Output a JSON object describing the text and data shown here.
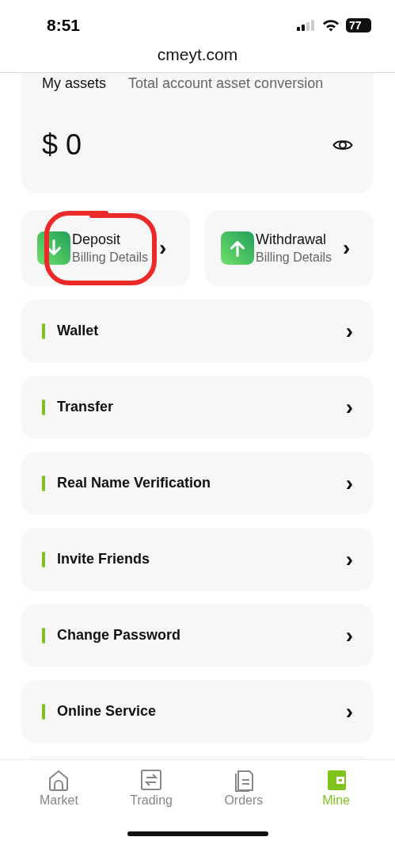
{
  "status_bar": {
    "time": "8:51",
    "battery": "77"
  },
  "address_bar": {
    "url": "cmeyt.com"
  },
  "assets": {
    "title": "My assets",
    "subtitle": "Total account asset conversion",
    "balance": "$ 0"
  },
  "actions": [
    {
      "kind": "deposit",
      "label": "Deposit",
      "sublabel": "Billing Details",
      "chevron": "›"
    },
    {
      "kind": "withdrawal",
      "label": "Withdrawal",
      "sublabel": "Billing Details",
      "chevron": "›"
    }
  ],
  "menu": [
    {
      "label": "Wallet",
      "chevron": "›"
    },
    {
      "label": "Transfer",
      "chevron": "›"
    },
    {
      "label": "Real Name Verification",
      "chevron": "›"
    },
    {
      "label": "Invite Friends",
      "chevron": "›"
    },
    {
      "label": "Change Password",
      "chevron": "›"
    },
    {
      "label": "Online Service",
      "chevron": "›"
    }
  ],
  "tabs": [
    {
      "kind": "home",
      "label": "Market",
      "selected": false
    },
    {
      "kind": "trading",
      "label": "Trading",
      "selected": false
    },
    {
      "kind": "orders",
      "label": "Orders",
      "selected": false
    },
    {
      "kind": "wallet",
      "label": "Mine",
      "selected": true
    }
  ]
}
